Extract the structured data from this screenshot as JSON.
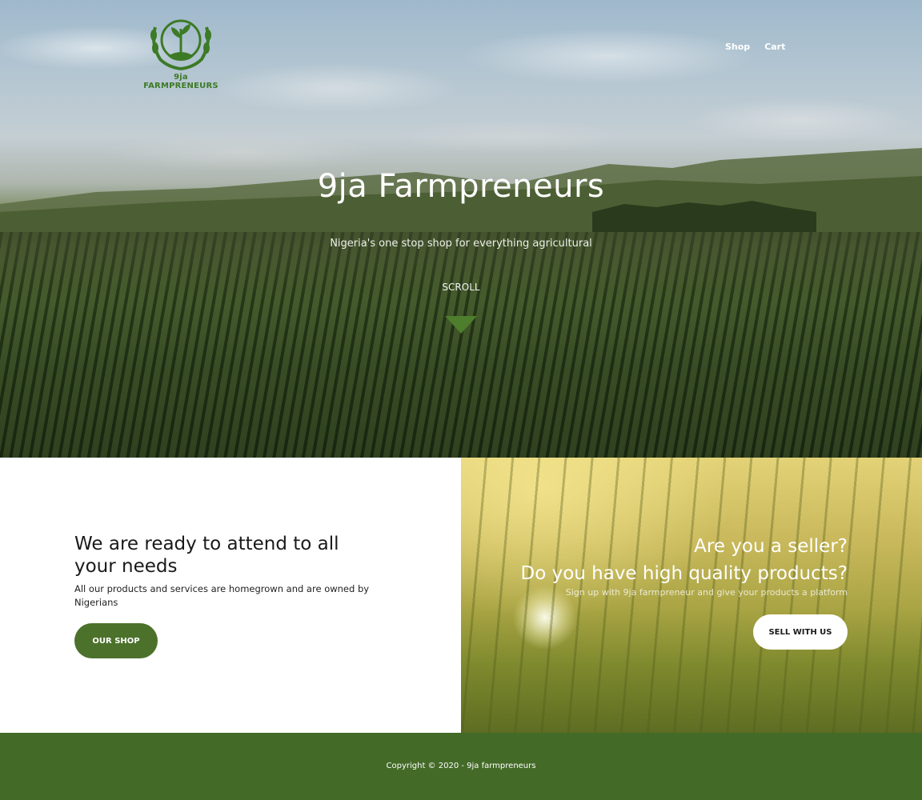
{
  "brand": {
    "logo_text": "9ja FARMPRENEURS",
    "logo_color": "#3d7a26"
  },
  "nav": {
    "items": [
      {
        "label": "Shop"
      },
      {
        "label": "Cart"
      }
    ]
  },
  "hero": {
    "title": "9ja Farmpreneurs",
    "subtitle": "Nigeria's one stop shop for everything agricultural",
    "scroll_label": "SCROLL",
    "arrow_icon": "triangle-down-icon",
    "arrow_color": "#4d7d2d"
  },
  "buyer_section": {
    "heading": "We are ready to attend to all your needs",
    "body": "All our products and services are homegrown and are owned by Nigerians",
    "button_label": "OUR SHOP",
    "button_color": "#4c712b"
  },
  "seller_section": {
    "heading_line1": "Are you a seller?",
    "heading_line2": "Do you have high quality products?",
    "body": "Sign up with 9ja farmpreneur and give your products a platform",
    "button_label": "SELL WITH US"
  },
  "footer": {
    "copyright": "Copyright © 2020 - 9ja farmpreneurs",
    "background_color": "#436a27"
  }
}
